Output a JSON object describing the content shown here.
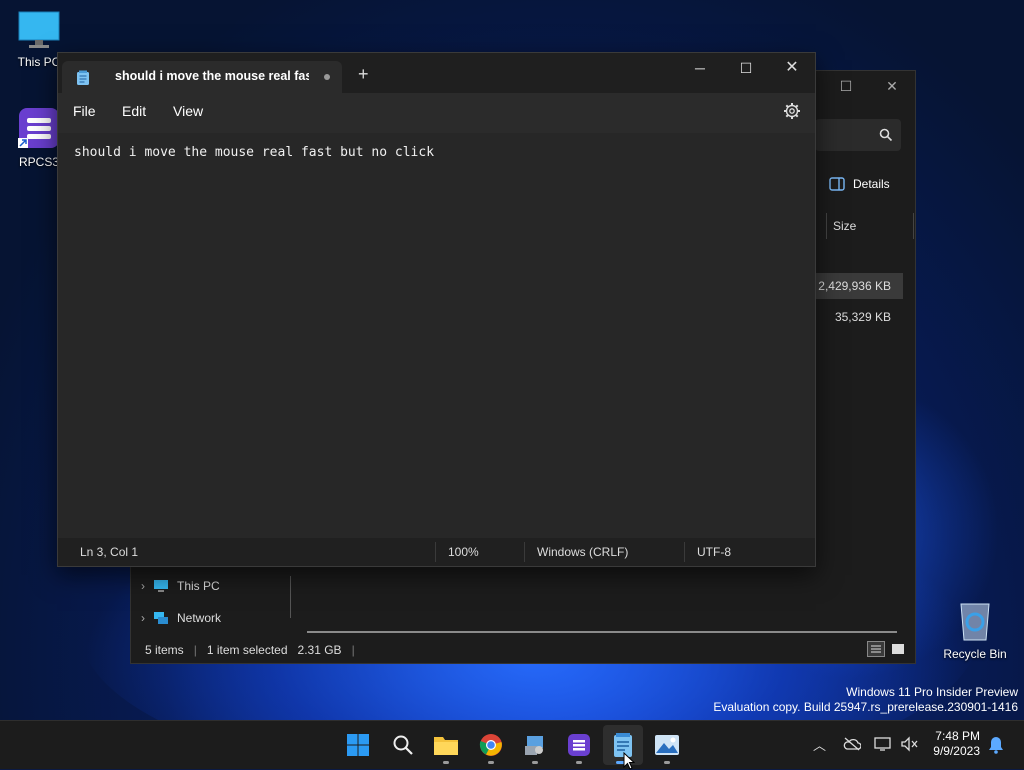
{
  "desktop": {
    "icons": [
      {
        "label": "This PC",
        "icon": "monitor-icon"
      },
      {
        "label": "RPCS3",
        "icon": "rpcs3-icon"
      },
      {
        "label": "Recycle Bin",
        "icon": "recycle-bin-icon"
      }
    ],
    "watermark": {
      "line1": "Windows 11 Pro Insider Preview",
      "line2": "Evaluation copy. Build 25947.rs_prerelease.230901-1416"
    }
  },
  "explorer": {
    "details_label": "Details",
    "column_size": "Size",
    "rows": [
      {
        "size": "2,429,936 KB",
        "selected": true
      },
      {
        "size": "35,329 KB",
        "selected": false
      }
    ],
    "nav": [
      {
        "label": "This PC",
        "icon": "monitor-icon"
      },
      {
        "label": "Network",
        "icon": "network-icon"
      }
    ],
    "status": {
      "items": "5 items",
      "selected": "1 item selected",
      "size": "2.31 GB"
    }
  },
  "notepad": {
    "tab_title": "should i move the mouse real fast but no click",
    "tab_modified": true,
    "menu": [
      "File",
      "Edit",
      "View"
    ],
    "content": "should i move the mouse real fast but no click",
    "status": {
      "position": "Ln 3, Col 1",
      "zoom": "100%",
      "line_ending": "Windows (CRLF)",
      "encoding": "UTF-8"
    }
  },
  "taskbar": {
    "apps": [
      "start-icon",
      "search-icon",
      "file-explorer-icon",
      "chrome-icon",
      "settings-tools-icon",
      "rpcs3-icon",
      "notepad-icon",
      "photos-icon"
    ],
    "active_app": "notepad-icon",
    "clock": {
      "time": "7:48 PM",
      "date": "9/9/2023"
    }
  }
}
